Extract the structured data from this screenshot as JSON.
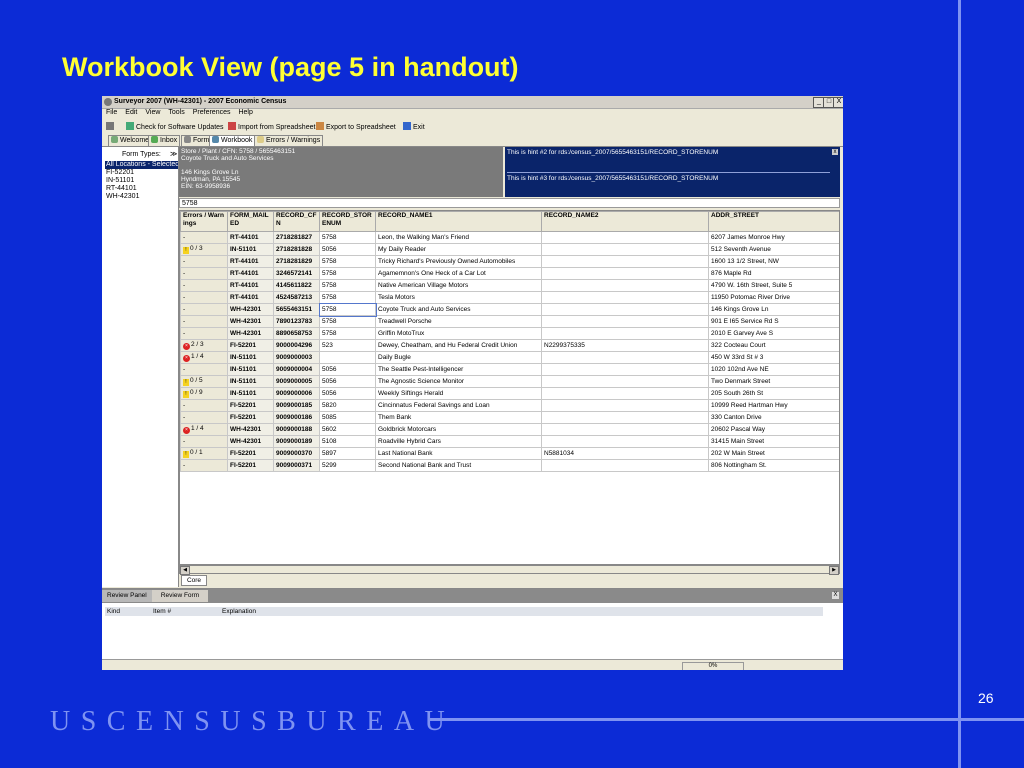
{
  "slide": {
    "title": "Workbook View (page 5 in handout)",
    "footer_logo": "USCENSUSBUREAU",
    "page_number": "26"
  },
  "window": {
    "title": "Surveyor 2007 (WH-42301) - 2007 Economic Census",
    "minimize": "_",
    "maximize": "□",
    "close": "X"
  },
  "menu": [
    "File",
    "Edit",
    "View",
    "Tools",
    "Preferences",
    "Help"
  ],
  "toolbar": {
    "check_updates": "Check for Software Updates",
    "import": "Import from Spreadsheet",
    "export": "Export to Spreadsheet",
    "exit": "Exit"
  },
  "tabs": [
    "Welcome",
    "Inbox",
    "Form",
    "Workbook",
    "Errors / Warnings"
  ],
  "left_panel": {
    "label": "Form Types:",
    "items": [
      "All Locations - Selected 0",
      "FI-52201",
      "IN-51101",
      "RT-44101",
      "WH-42301"
    ]
  },
  "info": {
    "line1": "Store / Plant / CFN:      5758 / 5655463151",
    "line2": "Coyote Truck and Auto Services",
    "line3": "146 Kings Grove Ln",
    "line4": "Hyndman, PA 15545",
    "line5": "EIN: 63-9958936"
  },
  "hints": {
    "hint1": "This is hint #2 for rds:/census_2007/5655463151/RECORD_STORENUM",
    "hint2": "This is hint #3 for rds:/census_2007/5655463151/RECORD_STORENUM"
  },
  "cell_input": "5758",
  "grid": {
    "columns": [
      "Errors / Warnings",
      "FORM_MAILED",
      "RECORD_CFN",
      "RECORD_STORENUM",
      "RECORD_NAME1",
      "RECORD_NAME2",
      "ADDR_STREET"
    ],
    "rows": [
      {
        "status": "-",
        "form": "RT-44101",
        "cfn": "2718281827",
        "store": "5758",
        "name1": "Leon, the Walking Man's Friend",
        "name2": "",
        "addr": "6207 James Monroe Hwy"
      },
      {
        "status": "0 / 3",
        "icon": "warning",
        "form": "IN-51101",
        "cfn": "2718281828",
        "store": "5056",
        "name1": "My Daily Reader",
        "name2": "",
        "addr": "512 Seventh Avenue"
      },
      {
        "status": "-",
        "form": "RT-44101",
        "cfn": "2718281829",
        "store": "5758",
        "name1": "Tricky Richard's Previously Owned Automobiles",
        "name2": "",
        "addr": "1600 13 1/2 Street, NW"
      },
      {
        "status": "-",
        "form": "RT-44101",
        "cfn": "3246572141",
        "store": "5758",
        "name1": "Agamemnon's One Heck of a Car Lot",
        "name2": "",
        "addr": "876 Maple Rd"
      },
      {
        "status": "-",
        "form": "RT-44101",
        "cfn": "4145611822",
        "store": "5758",
        "name1": "Native American Village Motors",
        "name2": "",
        "addr": "4790 W. 16th Street, Suite 5"
      },
      {
        "status": "-",
        "form": "RT-44101",
        "cfn": "4524587213",
        "store": "5758",
        "name1": "Tesla Motors",
        "name2": "",
        "addr": "11950 Potomac River Drive"
      },
      {
        "status": "-",
        "form": "WH-42301",
        "cfn": "5655463151",
        "store": "5758",
        "name1": "Coyote Truck and Auto Services",
        "name2": "",
        "addr": "146 Kings Grove Ln",
        "selected": true
      },
      {
        "status": "-",
        "form": "WH-42301",
        "cfn": "7890123783",
        "store": "5758",
        "name1": "Treadwell Porsche",
        "name2": "",
        "addr": "901 E I65 Service Rd S"
      },
      {
        "status": "-",
        "form": "WH-42301",
        "cfn": "8890658753",
        "store": "5758",
        "name1": "Griffin MotoTrux",
        "name2": "",
        "addr": "2010 E Garvey Ave S"
      },
      {
        "status": "2 / 3",
        "icon": "error",
        "form": "FI-52201",
        "cfn": "9000004296",
        "store": "523",
        "name1": "Dewey, Cheatham, and Hu Federal Credit Union",
        "name2": "N2299375335",
        "addr": "322 Cocteau Court"
      },
      {
        "status": "1 / 4",
        "icon": "error",
        "form": "IN-51101",
        "cfn": "9009000003",
        "store": "",
        "name1": "Daily Bugle",
        "name2": "",
        "addr": "450 W 33rd St # 3"
      },
      {
        "status": "-",
        "form": "IN-51101",
        "cfn": "9009000004",
        "store": "5056",
        "name1": "The Seattle Pest-Intelligencer",
        "name2": "",
        "addr": "1020 102nd Ave NE"
      },
      {
        "status": "0 / 5",
        "icon": "warning",
        "form": "IN-51101",
        "cfn": "9009000005",
        "store": "5056",
        "name1": "The Agnostic Science Monitor",
        "name2": "",
        "addr": "Two Denmark Street"
      },
      {
        "status": "0 / 9",
        "icon": "warning",
        "form": "IN-51101",
        "cfn": "9009000006",
        "store": "5056",
        "name1": "Weekly Siftings Herald",
        "name2": "",
        "addr": "205 South 26th St"
      },
      {
        "status": "-",
        "form": "FI-52201",
        "cfn": "9009000185",
        "store": "5820",
        "name1": "Cincinnatus Federal Savings and Loan",
        "name2": "",
        "addr": "10999 Reed Hartman Hwy"
      },
      {
        "status": "-",
        "form": "FI-52201",
        "cfn": "9009000186",
        "store": "5085",
        "name1": "Them Bank",
        "name2": "",
        "addr": "330 Canton Drive"
      },
      {
        "status": "1 / 4",
        "icon": "error",
        "form": "WH-42301",
        "cfn": "9009000188",
        "store": "5602",
        "name1": "Goldbrick Motorcars",
        "name2": "",
        "addr": "20602 Pascal Way"
      },
      {
        "status": "-",
        "form": "WH-42301",
        "cfn": "9009000189",
        "store": "5108",
        "name1": "Roadville Hybrid Cars",
        "name2": "",
        "addr": "31415 Main Street"
      },
      {
        "status": "0 / 1",
        "icon": "warning",
        "form": "FI-52201",
        "cfn": "9009000370",
        "store": "5897",
        "name1": "Last National Bank",
        "name2": "N5881034",
        "addr": "202 W Main Street"
      },
      {
        "status": "-",
        "form": "FI-52201",
        "cfn": "9009000371",
        "store": "5299",
        "name1": "Second National Bank and Trust",
        "name2": "",
        "addr": "806 Nottingham St."
      }
    ]
  },
  "sheet_tab": "Core",
  "bottom_panel": {
    "tab_review_panel": "Review Panel",
    "tab_review_form": "Review Form",
    "close": "X",
    "headers": [
      "Kind",
      "Item #",
      "Explanation"
    ]
  },
  "status": {
    "percent": "0%"
  },
  "colors": {
    "slide_bg": "#0c2bd6",
    "title": "#ffff33",
    "accent_lines": "#7f93f2",
    "hint_bg": "#0a246a",
    "error": "#dd2222",
    "warning": "#f5d21f"
  }
}
